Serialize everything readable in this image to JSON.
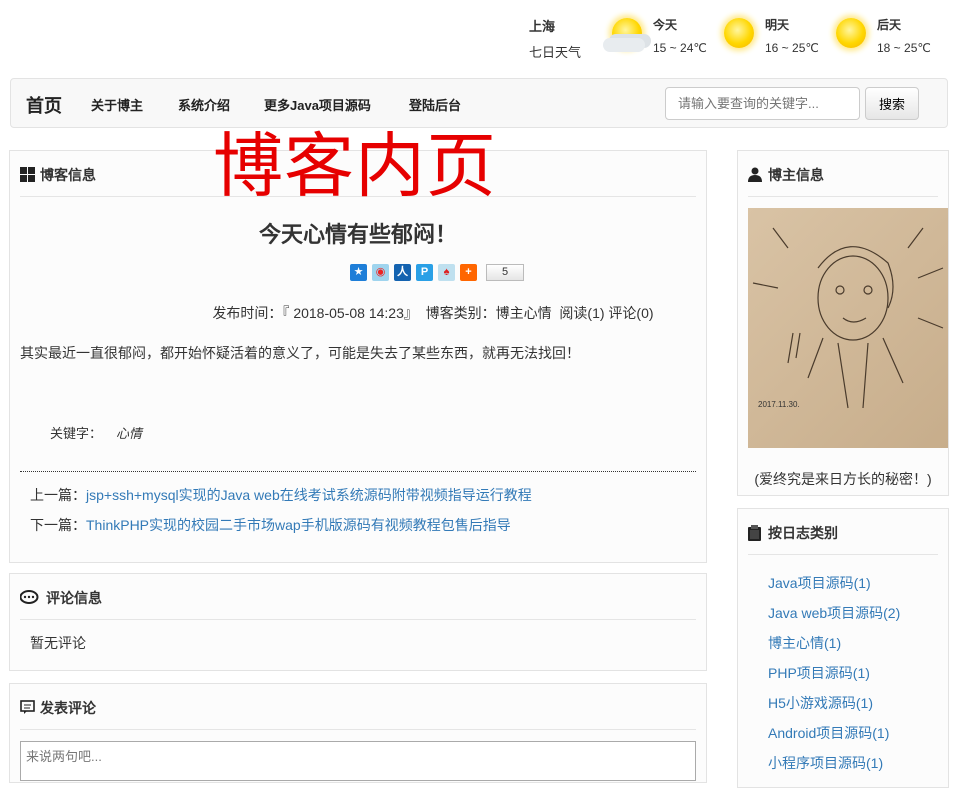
{
  "weather": {
    "city": "上海",
    "link": "七日天气",
    "days": [
      {
        "label": "今天",
        "temp": "15 ~ 24℃",
        "icon": "sun-cloud-icon"
      },
      {
        "label": "明天",
        "temp": "16 ~ 25℃",
        "icon": "sun-icon"
      },
      {
        "label": "后天",
        "temp": "18 ~ 25℃",
        "icon": "sun-icon"
      }
    ]
  },
  "nav": {
    "home": "首页",
    "items": [
      "关于博主",
      "系统介绍",
      "更多Java项目源码",
      "登陆后台"
    ],
    "search_placeholder": "请输入要查询的关键字...",
    "search_button": "搜索"
  },
  "overlay": "博客内页",
  "blog": {
    "header": "博客信息",
    "title": "今天心情有些郁闷！",
    "share_count": "5",
    "meta": "发布时间：『 2018-05-08 14:23』  博客类别：博主心情  阅读(1) 评论(0)",
    "content": "其实最近一直很郁闷，都开始怀疑活着的意义了，可能是失去了某些东西，就再无法找回！",
    "keyword_label": "关键字：",
    "keyword": "心情",
    "prev_label": "上一篇：",
    "prev_link": "jsp+ssh+mysql实现的Java web在线考试系统源码附带视频指导运行教程",
    "next_label": "下一篇：",
    "next_link": "ThinkPHP实现的校园二手市场wap手机版源码有视频教程包售后指导"
  },
  "comments": {
    "header": "评论信息",
    "empty": "暂无评论"
  },
  "post": {
    "header": "发表评论",
    "placeholder": "来说两句吧..."
  },
  "blogger": {
    "header": "博主信息",
    "motto": "(爱终究是来日方长的秘密！)",
    "sketch_date": "2017.11.30."
  },
  "categories": {
    "header": "按日志类别",
    "items": [
      "Java项目源码(1)",
      "Java web项目源码(2)",
      "博主心情(1)",
      "PHP项目源码(1)",
      "H5小游戏源码(1)",
      "Android项目源码(1)",
      "小程序项目源码(1)"
    ]
  },
  "colors": {
    "accent": "#337ab7",
    "overlay": "#e60000"
  }
}
